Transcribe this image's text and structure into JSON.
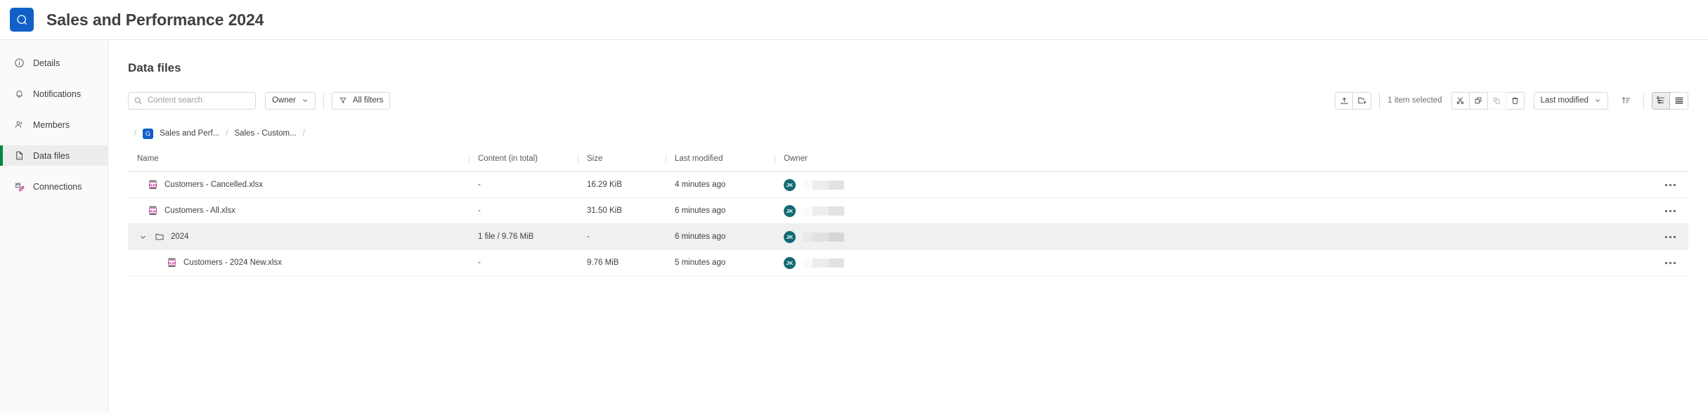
{
  "header": {
    "app_title": "Sales and Performance 2024",
    "logo_icon": "qlik-logo-icon"
  },
  "sidebar": {
    "items": [
      {
        "label": "Details",
        "icon": "info-circle-icon",
        "selected": false
      },
      {
        "label": "Notifications",
        "icon": "bell-icon",
        "selected": false
      },
      {
        "label": "Members",
        "icon": "people-icon",
        "selected": false
      },
      {
        "label": "Data files",
        "icon": "file-data-icon",
        "selected": true
      },
      {
        "label": "Connections",
        "icon": "connections-icon",
        "selected": false
      }
    ]
  },
  "main": {
    "page_title": "Data files",
    "toolbar": {
      "search_placeholder": "Content search",
      "search_value": "",
      "owner_label": "Owner",
      "all_filters_label": "All filters",
      "selection_text": "1 item selected",
      "sort_label": "Last modified",
      "upload_icon": "upload-icon",
      "new_folder_icon": "new-folder-icon",
      "cut_icon": "scissors-icon",
      "copy_icon": "copy-icon",
      "paste_icon": "paste-icon",
      "delete_icon": "trash-icon",
      "sort_direction_icon": "sort-ascending-icon",
      "tree_view_icon": "tree-view-icon",
      "list_view_icon": "list-view-icon",
      "active_view": "tree"
    },
    "breadcrumb": {
      "leading_separator": "/",
      "items": [
        {
          "label": "Sales and Perf...",
          "has_logo": true
        },
        {
          "label": "Sales - Custom...",
          "has_logo": false
        }
      ],
      "separator": "/",
      "trailing_separator": "/"
    },
    "table": {
      "columns": [
        {
          "key": "name",
          "label": "Name"
        },
        {
          "key": "content",
          "label": "Content (in total)"
        },
        {
          "key": "size",
          "label": "Size"
        },
        {
          "key": "mod",
          "label": "Last modified"
        },
        {
          "key": "owner",
          "label": "Owner"
        }
      ],
      "rows": [
        {
          "type": "file",
          "indent": 1,
          "icon": "xlsx-file-icon",
          "name": "Customers - Cancelled.xlsx",
          "content": "-",
          "size": "16.29 KiB",
          "mod": "4 minutes ago",
          "owner_initials": "JK",
          "selected": false,
          "expanded": null
        },
        {
          "type": "file",
          "indent": 1,
          "icon": "xlsx-file-icon",
          "name": "Customers - All.xlsx",
          "content": "-",
          "size": "31.50 KiB",
          "mod": "6 minutes ago",
          "owner_initials": "JK",
          "selected": false,
          "expanded": null
        },
        {
          "type": "folder",
          "indent": 0,
          "icon": "folder-icon",
          "name": "2024",
          "content": "1 file / 9.76 MiB",
          "size": "-",
          "mod": "6 minutes ago",
          "owner_initials": "JK",
          "selected": true,
          "expanded": true
        },
        {
          "type": "file",
          "indent": 2,
          "icon": "xlsx-file-icon",
          "name": "Customers - 2024 New.xlsx",
          "content": "-",
          "size": "9.76 MiB",
          "mod": "5 minutes ago",
          "owner_initials": "JK",
          "selected": false,
          "expanded": null
        }
      ],
      "row_menu_icon": "more-options-icon"
    }
  },
  "colors": {
    "brand_blue": "#1060c8",
    "selected_accent": "#00873d",
    "avatar_teal": "#106a73",
    "xlsx_magenta": "#b4117f"
  }
}
